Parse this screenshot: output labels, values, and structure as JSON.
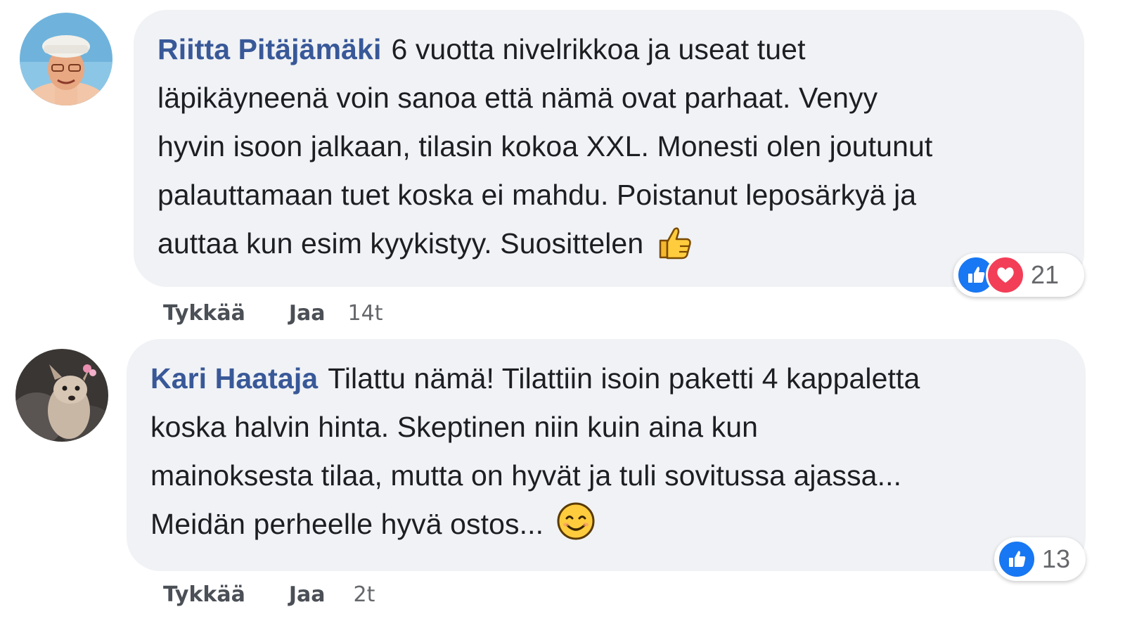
{
  "comments": [
    {
      "author": "Riitta Pitäjämäki",
      "lines": [
        "6 vuotta nivelrikkoa ja useat tuet",
        "läpikäyneenä voin sanoa että nämä ovat parhaat. Venyy",
        "hyvin isoon jalkaan, tilasin kokoa XXL. Monesti olen joutunut",
        "palauttamaan tuet koska ei mahdu. Poistanut leposärkyä ja",
        "auttaa kun esim kyykistyy. Suosittelen"
      ],
      "trailing_emoji": "thumbs-up",
      "reactions": [
        "like",
        "love"
      ],
      "reaction_count": "21",
      "actions": {
        "like": "Tykkää",
        "share": "Jaa",
        "time": "14t"
      }
    },
    {
      "author": "Kari Haataja",
      "lines": [
        "Tilattu nämä! Tilattiin isoin paketti 4 kappaletta",
        "koska halvin hinta. Skeptinen niin kuin aina kun",
        "mainoksesta tilaa, mutta on hyvät ja tuli sovitussa ajassa...",
        "Meidän perheelle hyvä ostos..."
      ],
      "trailing_emoji": "smiling-face",
      "reactions": [
        "like"
      ],
      "reaction_count": "13",
      "actions": {
        "like": "Tykkää",
        "share": "Jaa",
        "time": "2t"
      }
    }
  ],
  "colors": {
    "author": "#385898",
    "bubble": "#f0f2f5",
    "like": "#1877f2",
    "love": "#f33e58",
    "meta": "#65676b"
  }
}
